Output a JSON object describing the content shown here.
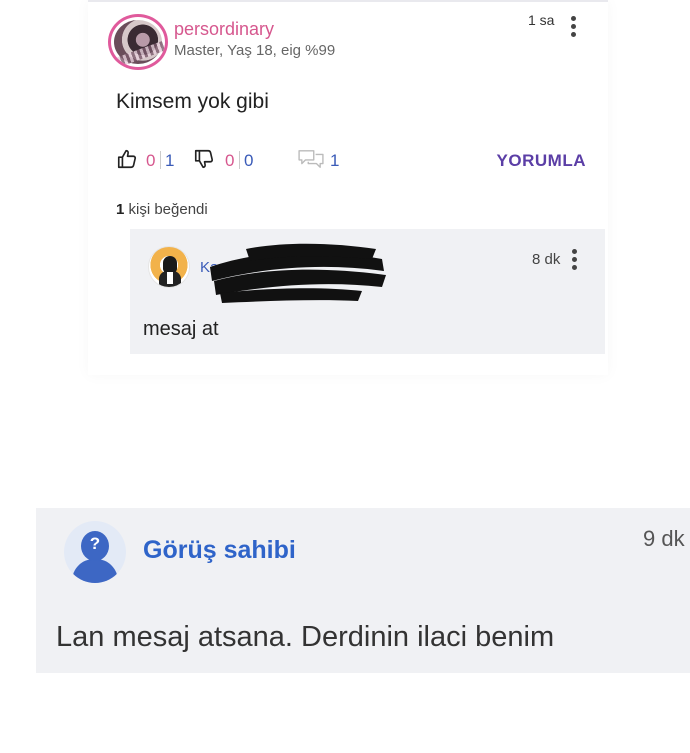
{
  "post": {
    "username": "persordinary",
    "user_meta": "Master, Yaş 18, eig %99",
    "time": "1 sa",
    "text": "Kimsem yok gibi",
    "like_count_a": "0",
    "like_count_b": "1",
    "dislike_count_a": "0",
    "dislike_count_b": "0",
    "comment_count": "1",
    "comment_button": "YORUMLA",
    "likes_number": "1",
    "likes_suffix": " kişi beğendi",
    "icons": [
      "thumbs-up-icon",
      "thumbs-down-icon",
      "comments-icon",
      "more-vertical-icon"
    ]
  },
  "reply": {
    "name_partial": "Ka",
    "time": "8 dk",
    "text": "mesaj at"
  },
  "opinion": {
    "author": "Görüş sahibi",
    "time": "9 dk",
    "avatar_symbol": "?",
    "text": "Lan mesaj atsana. Derdinin ilaci benim"
  },
  "colors": {
    "username": "#d6578e",
    "accent_purple": "#5b3ea6",
    "accent_blue": "#2f64c9",
    "card_bg": "#f0f1f4"
  }
}
